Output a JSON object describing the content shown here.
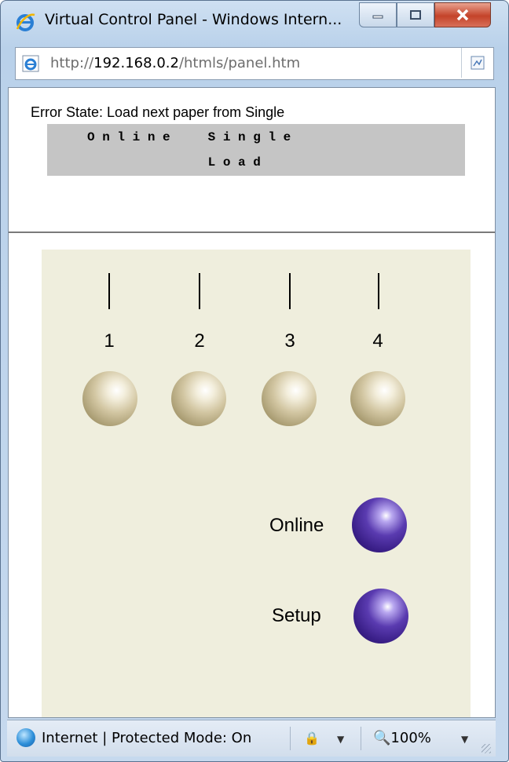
{
  "window": {
    "title": "Virtual Control Panel - Windows Intern...",
    "controls": [
      "minimize",
      "maximize",
      "close"
    ]
  },
  "address_bar": {
    "url_prefix": "http://",
    "url_host": "192.168.0.2",
    "url_path": "/htmls/panel.htm",
    "page_icon": "ie-page-icon",
    "compat_icon": "compatibility-view-icon"
  },
  "status_header": {
    "error_text": "Error State: Load next paper from Single",
    "lcd_line1": "O n l i n e     S i n g l e",
    "lcd_line2": "                L o a d"
  },
  "panel": {
    "indicators": [
      {
        "label": "1"
      },
      {
        "label": "2"
      },
      {
        "label": "3"
      },
      {
        "label": "4"
      }
    ],
    "buttons": [
      {
        "label": "Online",
        "color": "#4a2ea0"
      },
      {
        "label": "Setup",
        "color": "#4a2ea0"
      }
    ],
    "numbered_button_color": "#cfc4a0",
    "background": "#efeedd"
  },
  "statusbar": {
    "zone_text": "Internet | Protected Mode: On",
    "zoom": "100%"
  }
}
